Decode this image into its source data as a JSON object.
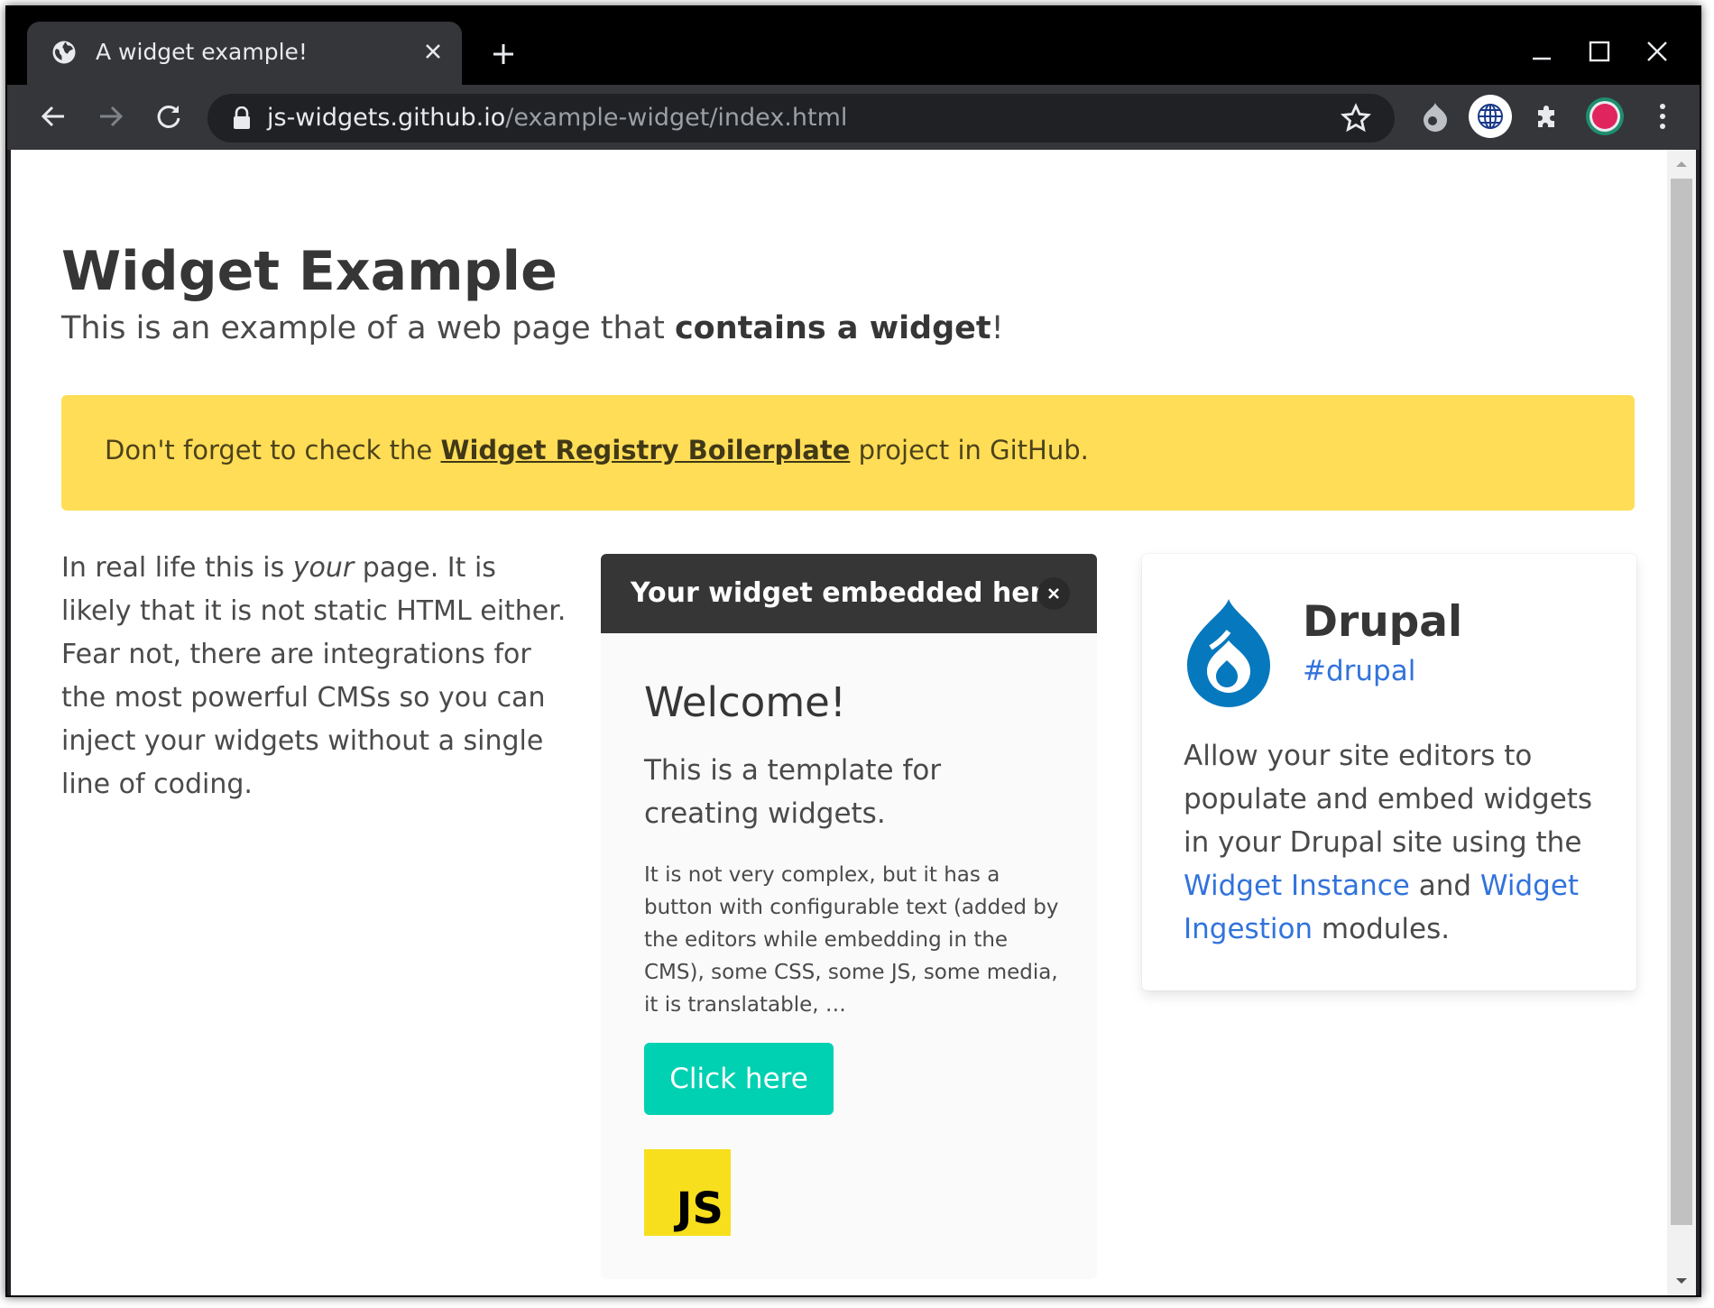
{
  "browser": {
    "tab_title": "A widget example!",
    "url_host": "js-widgets.github.io",
    "url_path": "/example-widget/index.html",
    "icons": [
      "globe-icon",
      "close-icon",
      "plus-icon",
      "minimize-icon",
      "maximize-icon",
      "back-icon",
      "forward-icon",
      "reload-icon",
      "lock-icon",
      "star-icon",
      "drupal-extension-icon",
      "globe-extension-icon",
      "puzzle-icon",
      "avatar-icon",
      "kebab-menu-icon"
    ]
  },
  "page": {
    "title": "Widget Example",
    "subtitle_prefix": "This is an example of a web page that ",
    "subtitle_bold": "contains a widget",
    "subtitle_suffix": "!",
    "notice_prefix": "Don't forget to check the ",
    "notice_link": "Widget Registry Boilerplate",
    "notice_suffix": " project in GitHub.",
    "left_prefix": "In real life this is ",
    "left_em": "your",
    "left_suffix": " page. It is likely that it is not static HTML either. Fear not, there are integrations for the most powerful CMSs so you can inject your widgets without a single line of coding."
  },
  "widget": {
    "header": "Your widget embedded here",
    "welcome": "Welcome!",
    "lead": "This is a template for creating widgets.",
    "small": "It is not very complex, but it has a button with configurable text (added by the editors while embedding in the CMS), some CSS, some JS, some media, it is translatable, …",
    "button": "Click here",
    "js_logo_text": "JS"
  },
  "card": {
    "name": "Drupal",
    "tag": "#drupal",
    "desc_prefix": "Allow your site editors to populate and embed widgets in your Drupal site using the ",
    "link1": "Widget Instance",
    "desc_mid": " and ",
    "link2": "Widget Ingestion",
    "desc_suffix": " modules."
  },
  "colors": {
    "notice_bg": "#ffdd57",
    "button_bg": "#00d1b2",
    "link": "#3273dc",
    "drupal_blue": "#0678be",
    "widget_header": "#363636"
  }
}
